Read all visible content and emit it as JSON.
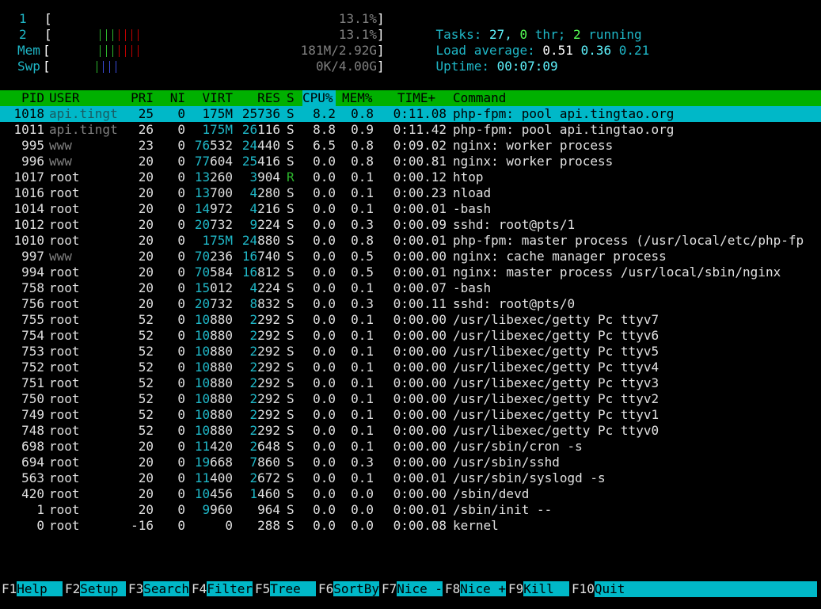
{
  "meters": {
    "cpu1": {
      "label": "1",
      "bracket_open": "[",
      "bars": "||||||",
      "value": "13.1%",
      "bracket_close": "]"
    },
    "cpu2": {
      "label": "2",
      "bracket_open": "[",
      "bars": "||||||",
      "value": "13.1%",
      "bracket_close": "]"
    },
    "mem": {
      "label": "Mem",
      "bracket_open": "[",
      "bars": "|||",
      "value": "181M/2.92G",
      "bracket_close": "]"
    },
    "swp": {
      "label": "Swp",
      "bracket_open": "[",
      "bars": "",
      "value": "0K/4.00G",
      "bracket_close": "]"
    }
  },
  "summary": {
    "tasks_label": "Tasks:",
    "tasks_count": "27,",
    "thr_count": "0",
    "thr_label": "thr;",
    "running_count": "2",
    "running_label": "running",
    "load_label": "Load average:",
    "load1": "0.51",
    "load5": "0.36",
    "load15": "0.21",
    "uptime_label": "Uptime:",
    "uptime_value": "00:07:09"
  },
  "table": {
    "columns": [
      "PID",
      "USER",
      "PRI",
      "NI",
      "VIRT",
      "RES",
      "S",
      "CPU%",
      "MEM%",
      "TIME+",
      "Command"
    ],
    "sort_column": "CPU%",
    "selected_pid": "1018",
    "rows": [
      {
        "pid": "1018",
        "user": "api.tingt",
        "pri": "25",
        "ni": "0",
        "virt": "175M",
        "res": "25736",
        "s": "S",
        "cpu": "8.2",
        "mem": "0.8",
        "time": "0:11.08",
        "cmd": "php-fpm: pool api.tingtao.org"
      },
      {
        "pid": "1011",
        "user": "api.tingt",
        "pri": "26",
        "ni": "0",
        "virt": "175M",
        "res": "26116",
        "s": "S",
        "cpu": "8.8",
        "mem": "0.9",
        "time": "0:11.42",
        "cmd": "php-fpm: pool api.tingtao.org"
      },
      {
        "pid": "995",
        "user": "www",
        "pri": "23",
        "ni": "0",
        "virt": "76532",
        "res": "24440",
        "s": "S",
        "cpu": "6.5",
        "mem": "0.8",
        "time": "0:09.02",
        "cmd": "nginx: worker process"
      },
      {
        "pid": "996",
        "user": "www",
        "pri": "20",
        "ni": "0",
        "virt": "77604",
        "res": "25416",
        "s": "S",
        "cpu": "0.0",
        "mem": "0.8",
        "time": "0:00.81",
        "cmd": "nginx: worker process"
      },
      {
        "pid": "1017",
        "user": "root",
        "pri": "20",
        "ni": "0",
        "virt": "13260",
        "res": "3904",
        "s": "R",
        "cpu": "0.0",
        "mem": "0.1",
        "time": "0:00.12",
        "cmd": "htop"
      },
      {
        "pid": "1016",
        "user": "root",
        "pri": "20",
        "ni": "0",
        "virt": "13700",
        "res": "4280",
        "s": "S",
        "cpu": "0.0",
        "mem": "0.1",
        "time": "0:00.23",
        "cmd": "nload"
      },
      {
        "pid": "1014",
        "user": "root",
        "pri": "20",
        "ni": "0",
        "virt": "14972",
        "res": "4216",
        "s": "S",
        "cpu": "0.0",
        "mem": "0.1",
        "time": "0:00.01",
        "cmd": "-bash"
      },
      {
        "pid": "1012",
        "user": "root",
        "pri": "20",
        "ni": "0",
        "virt": "20732",
        "res": "9224",
        "s": "S",
        "cpu": "0.0",
        "mem": "0.3",
        "time": "0:00.09",
        "cmd": "sshd: root@pts/1"
      },
      {
        "pid": "1010",
        "user": "root",
        "pri": "20",
        "ni": "0",
        "virt": "175M",
        "res": "24880",
        "s": "S",
        "cpu": "0.0",
        "mem": "0.8",
        "time": "0:00.01",
        "cmd": "php-fpm: master process (/usr/local/etc/php-fp"
      },
      {
        "pid": "997",
        "user": "www",
        "pri": "20",
        "ni": "0",
        "virt": "70236",
        "res": "16740",
        "s": "S",
        "cpu": "0.0",
        "mem": "0.5",
        "time": "0:00.00",
        "cmd": "nginx: cache manager process"
      },
      {
        "pid": "994",
        "user": "root",
        "pri": "20",
        "ni": "0",
        "virt": "70584",
        "res": "16812",
        "s": "S",
        "cpu": "0.0",
        "mem": "0.5",
        "time": "0:00.01",
        "cmd": "nginx: master process /usr/local/sbin/nginx"
      },
      {
        "pid": "758",
        "user": "root",
        "pri": "20",
        "ni": "0",
        "virt": "15012",
        "res": "4224",
        "s": "S",
        "cpu": "0.0",
        "mem": "0.1",
        "time": "0:00.07",
        "cmd": "-bash"
      },
      {
        "pid": "756",
        "user": "root",
        "pri": "20",
        "ni": "0",
        "virt": "20732",
        "res": "8832",
        "s": "S",
        "cpu": "0.0",
        "mem": "0.3",
        "time": "0:00.11",
        "cmd": "sshd: root@pts/0"
      },
      {
        "pid": "755",
        "user": "root",
        "pri": "52",
        "ni": "0",
        "virt": "10880",
        "res": "2292",
        "s": "S",
        "cpu": "0.0",
        "mem": "0.1",
        "time": "0:00.00",
        "cmd": "/usr/libexec/getty Pc ttyv7"
      },
      {
        "pid": "754",
        "user": "root",
        "pri": "52",
        "ni": "0",
        "virt": "10880",
        "res": "2292",
        "s": "S",
        "cpu": "0.0",
        "mem": "0.1",
        "time": "0:00.00",
        "cmd": "/usr/libexec/getty Pc ttyv6"
      },
      {
        "pid": "753",
        "user": "root",
        "pri": "52",
        "ni": "0",
        "virt": "10880",
        "res": "2292",
        "s": "S",
        "cpu": "0.0",
        "mem": "0.1",
        "time": "0:00.00",
        "cmd": "/usr/libexec/getty Pc ttyv5"
      },
      {
        "pid": "752",
        "user": "root",
        "pri": "52",
        "ni": "0",
        "virt": "10880",
        "res": "2292",
        "s": "S",
        "cpu": "0.0",
        "mem": "0.1",
        "time": "0:00.00",
        "cmd": "/usr/libexec/getty Pc ttyv4"
      },
      {
        "pid": "751",
        "user": "root",
        "pri": "52",
        "ni": "0",
        "virt": "10880",
        "res": "2292",
        "s": "S",
        "cpu": "0.0",
        "mem": "0.1",
        "time": "0:00.00",
        "cmd": "/usr/libexec/getty Pc ttyv3"
      },
      {
        "pid": "750",
        "user": "root",
        "pri": "52",
        "ni": "0",
        "virt": "10880",
        "res": "2292",
        "s": "S",
        "cpu": "0.0",
        "mem": "0.1",
        "time": "0:00.00",
        "cmd": "/usr/libexec/getty Pc ttyv2"
      },
      {
        "pid": "749",
        "user": "root",
        "pri": "52",
        "ni": "0",
        "virt": "10880",
        "res": "2292",
        "s": "S",
        "cpu": "0.0",
        "mem": "0.1",
        "time": "0:00.00",
        "cmd": "/usr/libexec/getty Pc ttyv1"
      },
      {
        "pid": "748",
        "user": "root",
        "pri": "52",
        "ni": "0",
        "virt": "10880",
        "res": "2292",
        "s": "S",
        "cpu": "0.0",
        "mem": "0.1",
        "time": "0:00.00",
        "cmd": "/usr/libexec/getty Pc ttyv0"
      },
      {
        "pid": "698",
        "user": "root",
        "pri": "20",
        "ni": "0",
        "virt": "11420",
        "res": "2648",
        "s": "S",
        "cpu": "0.0",
        "mem": "0.1",
        "time": "0:00.00",
        "cmd": "/usr/sbin/cron -s"
      },
      {
        "pid": "694",
        "user": "root",
        "pri": "20",
        "ni": "0",
        "virt": "19668",
        "res": "7860",
        "s": "S",
        "cpu": "0.0",
        "mem": "0.3",
        "time": "0:00.00",
        "cmd": "/usr/sbin/sshd"
      },
      {
        "pid": "563",
        "user": "root",
        "pri": "20",
        "ni": "0",
        "virt": "11400",
        "res": "2672",
        "s": "S",
        "cpu": "0.0",
        "mem": "0.1",
        "time": "0:00.01",
        "cmd": "/usr/sbin/syslogd -s"
      },
      {
        "pid": "420",
        "user": "root",
        "pri": "20",
        "ni": "0",
        "virt": "10456",
        "res": "1460",
        "s": "S",
        "cpu": "0.0",
        "mem": "0.0",
        "time": "0:00.00",
        "cmd": "/sbin/devd"
      },
      {
        "pid": "1",
        "user": "root",
        "pri": "20",
        "ni": "0",
        "virt": "9960",
        "res": "964",
        "s": "S",
        "cpu": "0.0",
        "mem": "0.0",
        "time": "0:00.01",
        "cmd": "/sbin/init --"
      },
      {
        "pid": "0",
        "user": "root",
        "pri": "-16",
        "ni": "0",
        "virt": "0",
        "res": "288",
        "s": "S",
        "cpu": "0.0",
        "mem": "0.0",
        "time": "0:00.08",
        "cmd": "kernel"
      }
    ]
  },
  "function_keys": [
    {
      "key": "F1",
      "label": "Help  "
    },
    {
      "key": "F2",
      "label": "Setup "
    },
    {
      "key": "F3",
      "label": "Search"
    },
    {
      "key": "F4",
      "label": "Filter"
    },
    {
      "key": "F5",
      "label": "Tree  "
    },
    {
      "key": "F6",
      "label": "SortBy"
    },
    {
      "key": "F7",
      "label": "Nice -"
    },
    {
      "key": "F8",
      "label": "Nice +"
    },
    {
      "key": "F9",
      "label": "Kill  "
    },
    {
      "key": "F10",
      "label": "Quit"
    }
  ],
  "colors": {
    "header_bg": "#00b000",
    "selected_bg": "#00b8c8",
    "label_cyan": "#1fb8c8",
    "value_bright": "#5ff5ff",
    "user_gray": "#808080",
    "running_green": "#2db82d"
  }
}
